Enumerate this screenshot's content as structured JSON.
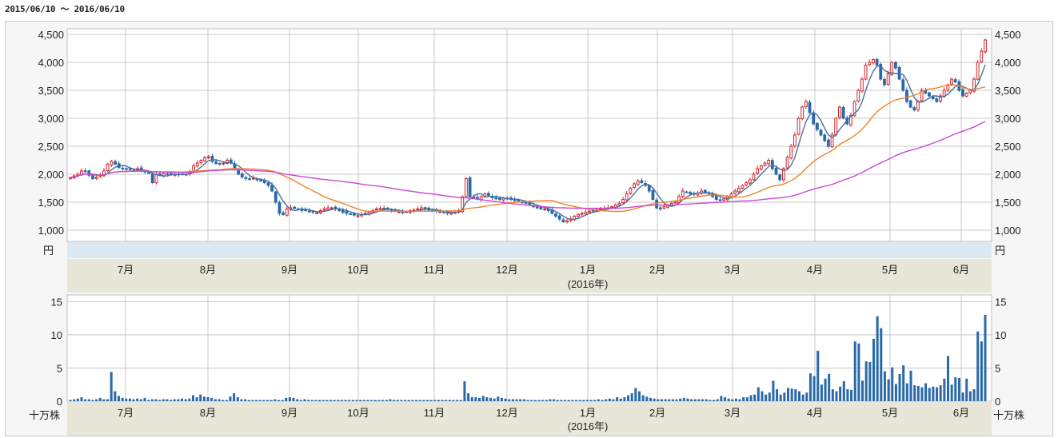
{
  "date_range": "2015/06/10 ～ 2016/06/10",
  "colors": {
    "up": "#d6242b",
    "down": "#2a6aa8",
    "ma_short": "#4a6fa0",
    "ma_mid": "#f0832a",
    "ma_long": "#c94ad6",
    "volume": "#2a6aa8",
    "grid": "#c8c8c8",
    "axis_band": "#e8e6d8",
    "unit_band": "#dce9f2"
  },
  "chart_data": [
    {
      "type": "candlestick",
      "name": "price",
      "ylim": [
        800,
        4600
      ],
      "y_ticks": [
        "1,000",
        "1,500",
        "2,000",
        "2,500",
        "3,000",
        "3,500",
        "4,000",
        "4,500"
      ],
      "y_tick_values": [
        1000,
        1500,
        2000,
        2500,
        3000,
        3500,
        4000,
        4500
      ],
      "unit_left": "円",
      "unit_right": "円",
      "x_tick_labels": [
        "7月",
        "8月",
        "9月",
        "10月",
        "11月",
        "12月",
        "1月",
        "2月",
        "3月",
        "4月",
        "5月",
        "6月"
      ],
      "year_label": "(2016年)",
      "grid": true,
      "closes": [
        1940,
        1970,
        2000,
        2060,
        2050,
        1980,
        1920,
        1950,
        1980,
        2060,
        2180,
        2230,
        2180,
        2120,
        2100,
        2090,
        2080,
        2070,
        2100,
        2060,
        2040,
        2020,
        1850,
        2000,
        1980,
        2010,
        2000,
        1990,
        2000,
        1990,
        2000,
        2000,
        2050,
        2150,
        2200,
        2250,
        2300,
        2310,
        2230,
        2190,
        2180,
        2200,
        2250,
        2200,
        2100,
        2000,
        1950,
        1920,
        1910,
        1930,
        1900,
        1880,
        1850,
        1800,
        1700,
        1500,
        1300,
        1280,
        1380,
        1400,
        1390,
        1380,
        1350,
        1350,
        1330,
        1320,
        1310,
        1350,
        1380,
        1400,
        1400,
        1380,
        1350,
        1320,
        1300,
        1290,
        1270,
        1260,
        1280,
        1300,
        1320,
        1350,
        1380,
        1390,
        1380,
        1370,
        1350,
        1340,
        1330,
        1320,
        1330,
        1350,
        1360,
        1380,
        1400,
        1380,
        1360,
        1350,
        1340,
        1330,
        1320,
        1300,
        1310,
        1320,
        1340,
        1600,
        1920,
        1600,
        1580,
        1560,
        1600,
        1650,
        1620,
        1580,
        1560,
        1550,
        1570,
        1560,
        1550,
        1540,
        1520,
        1500,
        1480,
        1450,
        1420,
        1400,
        1380,
        1380,
        1350,
        1300,
        1250,
        1200,
        1150,
        1170,
        1200,
        1250,
        1280,
        1300,
        1320,
        1340,
        1350,
        1370,
        1380,
        1390,
        1400,
        1420,
        1450,
        1480,
        1550,
        1650,
        1750,
        1830,
        1880,
        1850,
        1800,
        1700,
        1550,
        1400,
        1380,
        1420,
        1450,
        1480,
        1500,
        1600,
        1700,
        1680,
        1650,
        1640,
        1660,
        1700,
        1680,
        1650,
        1600,
        1550,
        1530,
        1560,
        1600,
        1650,
        1700,
        1750,
        1800,
        1850,
        1900,
        2000,
        2100,
        2150,
        2200,
        2250,
        2100,
        2000,
        1900,
        2100,
        2300,
        2500,
        2700,
        3000,
        3200,
        3300,
        3100,
        2900,
        2800,
        2700,
        2600,
        2500,
        2700,
        3000,
        3200,
        3000,
        2900,
        3050,
        3300,
        3500,
        3700,
        3950,
        4000,
        4050,
        3950,
        3700,
        3600,
        3800,
        4000,
        3900,
        3700,
        3500,
        3300,
        3200,
        3150,
        3300,
        3500,
        3450,
        3400,
        3350,
        3300,
        3400,
        3500,
        3600,
        3700,
        3650,
        3500,
        3400,
        3450,
        3500,
        3700,
        4000,
        4200,
        4400
      ]
    },
    {
      "type": "bar",
      "name": "volume",
      "ylim": [
        0,
        16
      ],
      "y_ticks": [
        "0",
        "5",
        "10",
        "15"
      ],
      "y_tick_values": [
        0,
        5,
        10,
        15
      ],
      "unit_left": "十万株",
      "unit_right": "十万株",
      "x_tick_labels": [
        "7月",
        "8月",
        "9月",
        "10月",
        "11月",
        "12月",
        "1月",
        "2月",
        "3月",
        "4月",
        "5月",
        "6月"
      ],
      "year_label": "(2016年)",
      "grid": true,
      "values": [
        0.2,
        0.3,
        0.4,
        0.6,
        0.3,
        0.3,
        0.2,
        0.3,
        0.5,
        0.3,
        0.3,
        4.4,
        1.5,
        0.8,
        0.5,
        0.4,
        0.4,
        0.3,
        0.4,
        0.3,
        0.5,
        0.2,
        0.3,
        0.3,
        0.2,
        0.3,
        0.3,
        0.2,
        0.3,
        0.3,
        0.4,
        0.3,
        0.4,
        0.9,
        0.6,
        1.0,
        0.7,
        0.6,
        0.5,
        0.3,
        0.3,
        0.2,
        0.2,
        0.7,
        1.2,
        0.6,
        0.3,
        0.3,
        0.2,
        0.2,
        0.2,
        0.2,
        0.2,
        0.2,
        0.2,
        0.3,
        0.2,
        0.2,
        0.5,
        0.6,
        0.5,
        0.3,
        0.2,
        0.3,
        0.2,
        0.2,
        0.2,
        0.2,
        0.2,
        0.2,
        0.2,
        0.2,
        0.2,
        0.2,
        0.2,
        0.2,
        0.2,
        0.2,
        0.2,
        0.2,
        0.2,
        0.2,
        0.2,
        0.2,
        0.2,
        0.2,
        0.3,
        0.2,
        0.2,
        0.2,
        0.2,
        0.2,
        0.2,
        0.2,
        0.2,
        0.2,
        0.2,
        0.2,
        0.2,
        0.2,
        0.2,
        0.2,
        0.2,
        0.2,
        0.2,
        0.2,
        3.0,
        1.2,
        0.6,
        0.6,
        0.5,
        0.8,
        0.6,
        0.5,
        0.4,
        0.7,
        0.5,
        0.4,
        0.3,
        0.3,
        0.3,
        0.3,
        0.3,
        0.2,
        0.2,
        0.2,
        0.2,
        0.2,
        0.2,
        0.3,
        0.3,
        0.2,
        0.2,
        0.2,
        0.2,
        0.2,
        0.2,
        0.2,
        0.2,
        0.2,
        0.2,
        0.2,
        0.3,
        0.2,
        0.3,
        0.4,
        0.3,
        0.6,
        0.4,
        0.6,
        0.9,
        1.2,
        2.0,
        1.5,
        0.9,
        0.7,
        0.5,
        0.4,
        0.3,
        0.3,
        0.3,
        0.3,
        0.3,
        0.3,
        0.4,
        0.5,
        0.4,
        0.3,
        0.3,
        0.3,
        0.3,
        0.3,
        0.2,
        0.2,
        0.3,
        0.8,
        0.6,
        0.4,
        0.3,
        0.4,
        0.3,
        0.6,
        0.6,
        0.9,
        1.0,
        2.1,
        1.5,
        1.0,
        1.3,
        3.1,
        1.8,
        1.0,
        1.3,
        2.0,
        1.9,
        1.8,
        1.5,
        1.0,
        1.3,
        4.2,
        3.8,
        7.6,
        2.5,
        3.4,
        4.1,
        1.8,
        1.5,
        2.2,
        3.0,
        1.8,
        1.7,
        9.0,
        8.7,
        3.1,
        6.0,
        5.9,
        9.4,
        12.8,
        11.0,
        4.5,
        3.3,
        5.1,
        2.6,
        4.1,
        5.4,
        2.7,
        4.6,
        2.4,
        2.3,
        2.1,
        2.7,
        2.0,
        2.2,
        2.1,
        2.4,
        3.4,
        6.8,
        2.5,
        3.6,
        3.5,
        1.3,
        3.4,
        1.5,
        1.8,
        10.5,
        9.0,
        13.0
      ]
    }
  ]
}
